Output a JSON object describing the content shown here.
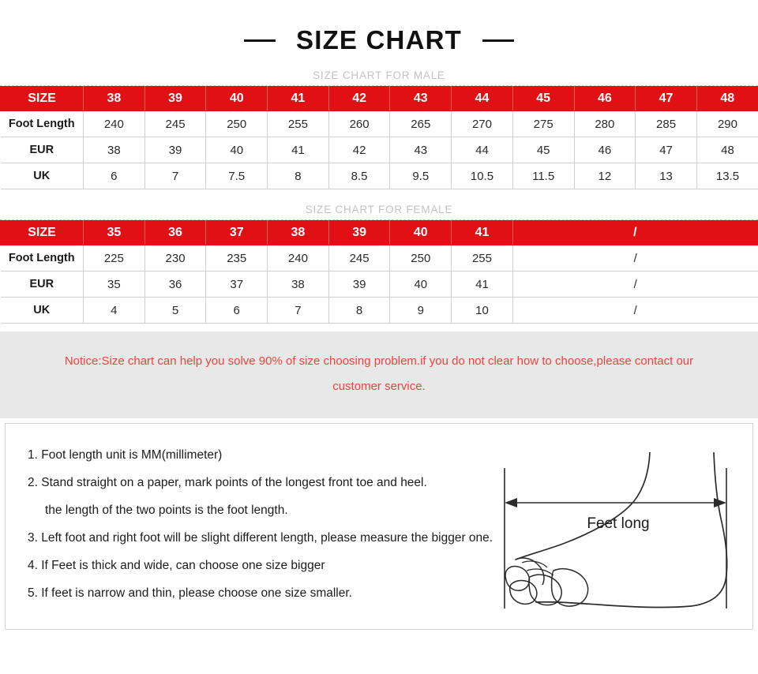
{
  "title": "SIZE CHART",
  "colors": {
    "accent_red": "#e01015",
    "notice_red": "#e8453c",
    "notice_band_bg": "#e8e8e8",
    "label_gray": "#c3c3c3"
  },
  "male_section": {
    "label": "SIZE CHART FOR MALE",
    "table": {
      "header": [
        "SIZE",
        "38",
        "39",
        "40",
        "41",
        "42",
        "43",
        "44",
        "45",
        "46",
        "47",
        "48"
      ],
      "rows": [
        {
          "label": "Foot Length",
          "values": [
            "240",
            "245",
            "250",
            "255",
            "260",
            "265",
            "270",
            "275",
            "280",
            "285",
            "290"
          ]
        },
        {
          "label": "EUR",
          "values": [
            "38",
            "39",
            "40",
            "41",
            "42",
            "43",
            "44",
            "45",
            "46",
            "47",
            "48"
          ]
        },
        {
          "label": "UK",
          "values": [
            "6",
            "7",
            "7.5",
            "8",
            "8.5",
            "9.5",
            "10.5",
            "11.5",
            "12",
            "13",
            "13.5"
          ]
        }
      ]
    }
  },
  "female_section": {
    "label": "SIZE CHART FOR FEMALE",
    "table": {
      "header": [
        "SIZE",
        "35",
        "36",
        "37",
        "38",
        "39",
        "40",
        "41"
      ],
      "header_merged": "/",
      "rows": [
        {
          "label": "Foot Length",
          "values": [
            "225",
            "230",
            "235",
            "240",
            "245",
            "250",
            "255"
          ],
          "merged": "/"
        },
        {
          "label": "EUR",
          "values": [
            "35",
            "36",
            "37",
            "38",
            "39",
            "40",
            "41"
          ],
          "merged": "/"
        },
        {
          "label": "UK",
          "values": [
            "4",
            "5",
            "6",
            "7",
            "8",
            "9",
            "10"
          ],
          "merged": "/"
        }
      ]
    }
  },
  "notice": {
    "line1": "Notice:Size chart can help you solve 90% of size choosing problem.if you do not clear how to choose,please contact our",
    "line2": "customer service."
  },
  "instructions": [
    "1. Foot length unit is MM(millimeter)",
    "2. Stand straight on a paper, mark points of the longest front toe and heel.",
    "the length of the two points is the foot length.",
    "3. Left foot and right foot will be slight different length, please measure the bigger one.",
    "4. If Feet is thick and wide, can choose one size bigger",
    "5. If feet is narrow and thin, please choose one size smaller."
  ],
  "diagram": {
    "measure_label": "Feet long"
  }
}
